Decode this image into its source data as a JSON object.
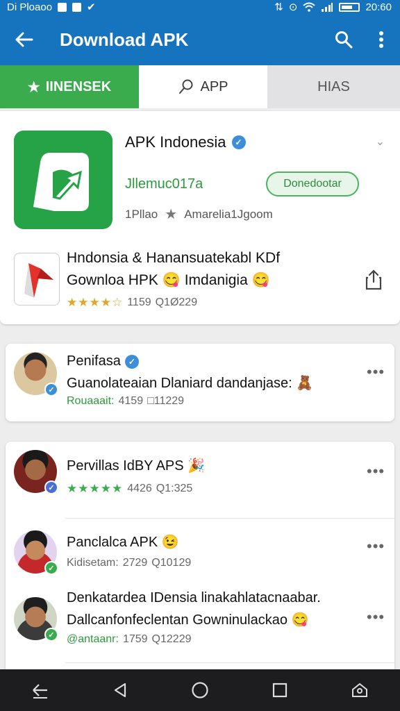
{
  "statusbar": {
    "left_text": "Di Ploaoo",
    "time": "20:60"
  },
  "appbar": {
    "title": "Download APK"
  },
  "tabs": [
    {
      "label": "IINENSEK"
    },
    {
      "label": "APP"
    },
    {
      "label": "HIAS"
    }
  ],
  "app": {
    "name": "APK Indonesia",
    "developer": "Jllemuc017a",
    "download_label": "Donedootar",
    "meta_left": "1Pllao",
    "meta_right": "Amarelia1Jgoom"
  },
  "related": {
    "title_line1": "Hndonsia & Hanansuatekabl KDf",
    "title_line2": "Gownloa HPK 😋 Imdanigia 😋",
    "stars": "★★★★☆",
    "count1": "1159",
    "count2": "Q1Ø229"
  },
  "posts": [
    {
      "name": "Penifasa",
      "text": "Guanolateaian Dlaniard dandanjase: 🧸",
      "meta_label": "Rouaaait:",
      "count1": "4159",
      "count2": "□11229"
    },
    {
      "name": "Pervillas IdBY APS 🎉",
      "stars": "★★★★★",
      "count1": "4426",
      "count2": "Q1:325"
    },
    {
      "name": "Panclalca APK 😉",
      "meta_label": "Kidisetam:",
      "count1": "2729",
      "count2": "Q10129"
    },
    {
      "text1": "Denkatardea IDensia linakahlatacnaabar.",
      "text2": "Dallcanfonfeclentan Gowninulackao 😋",
      "meta_label": "@antaanr:",
      "count1": "1759",
      "count2": "Q12229"
    }
  ],
  "colors": {
    "primary": "#1673bd",
    "accent_green": "#3aac4e",
    "star": "#e3a52a",
    "verified": "#3d8ed8"
  }
}
